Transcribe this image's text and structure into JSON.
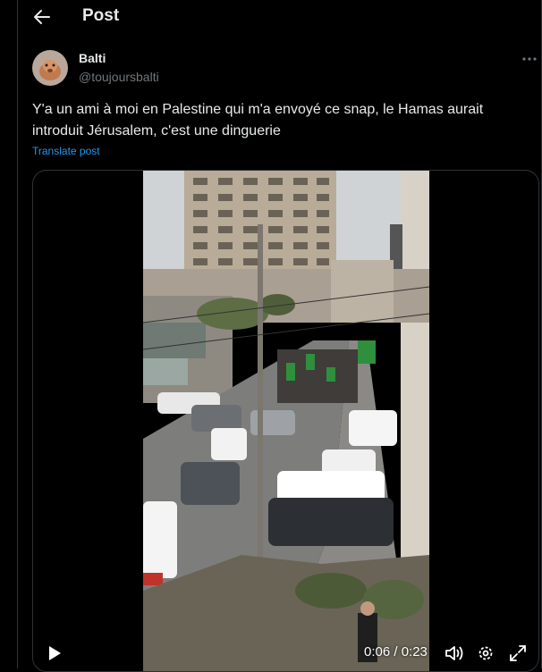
{
  "header": {
    "title": "Post"
  },
  "post": {
    "author_name": "Balti",
    "author_handle": "@toujoursbalti",
    "text": "Y'a un ami à moi en Palestine qui m'a envoyé ce snap, le Hamas aurait introduit Jérusalem, c'est une dinguerie",
    "translate_label": "Translate post"
  },
  "video": {
    "time_display": "0:06 / 0:23",
    "progress": 0.26
  },
  "icons": {
    "back": "arrow-left-icon",
    "more": "more-horizontal-icon",
    "play": "play-icon",
    "volume": "volume-icon",
    "settings": "gear-icon",
    "fullscreen": "fullscreen-icon"
  },
  "colors": {
    "background": "#000000",
    "text": "#e7e9ea",
    "muted": "#71767b",
    "link": "#1d9bf0",
    "border": "#2f3336"
  }
}
